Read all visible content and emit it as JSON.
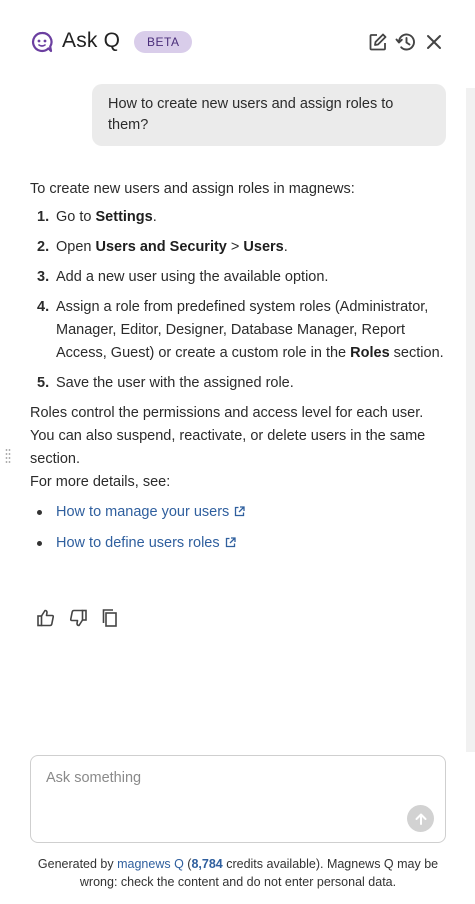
{
  "header": {
    "title": "Ask Q",
    "badge": "BETA",
    "icons": {
      "logo": "chat-bubble-q-icon",
      "edit": "edit-icon",
      "history": "history-icon",
      "close": "close-icon"
    }
  },
  "conversation": {
    "user_message": "How to create new users and assign roles to them?",
    "answer": {
      "intro": "To create new users and assign roles in magnews:",
      "steps": [
        {
          "num": "1.",
          "pre": "Go to ",
          "b1": "Settings",
          "mid": ".",
          "b2": "",
          "post": ""
        },
        {
          "num": "2.",
          "pre": "Open ",
          "b1": "Users and Security",
          "mid": " > ",
          "b2": "Users",
          "post": "."
        },
        {
          "num": "3.",
          "pre": "Add a new user using the available option.",
          "b1": "",
          "mid": "",
          "b2": "",
          "post": ""
        },
        {
          "num": "4.",
          "pre": "Assign a role from predefined system roles (Administrator, Manager, Editor, Designer, Database Manager, Report Access, Guest) or create a custom role in the ",
          "b1": "Roles",
          "mid": " section.",
          "b2": "",
          "post": ""
        },
        {
          "num": "5.",
          "pre": "Save the user with the assigned role.",
          "b1": "",
          "mid": "",
          "b2": "",
          "post": ""
        }
      ],
      "paragraph": "Roles control the permissions and access level for each user. You can also suspend, reactivate, or delete users in the same section.",
      "more_details": "For more details, see:",
      "links": [
        {
          "label": "How to manage your users"
        },
        {
          "label": "How to define users roles"
        }
      ]
    },
    "feedback_icons": [
      "thumbs-up-icon",
      "thumbs-down-icon",
      "copy-icon"
    ]
  },
  "composer": {
    "placeholder": "Ask something",
    "send_icon": "arrow-up-icon"
  },
  "footer": {
    "prefix": "Generated by ",
    "link": "magnews Q",
    "open": " (",
    "credits": "8,784",
    "suffix": " credits available). Magnews Q may be wrong: check the content and do not enter personal data."
  },
  "colors": {
    "accent": "#6b3fa0",
    "badge_bg": "#d9cdea",
    "link": "#2f5f9e",
    "user_bubble": "#ebebeb"
  }
}
